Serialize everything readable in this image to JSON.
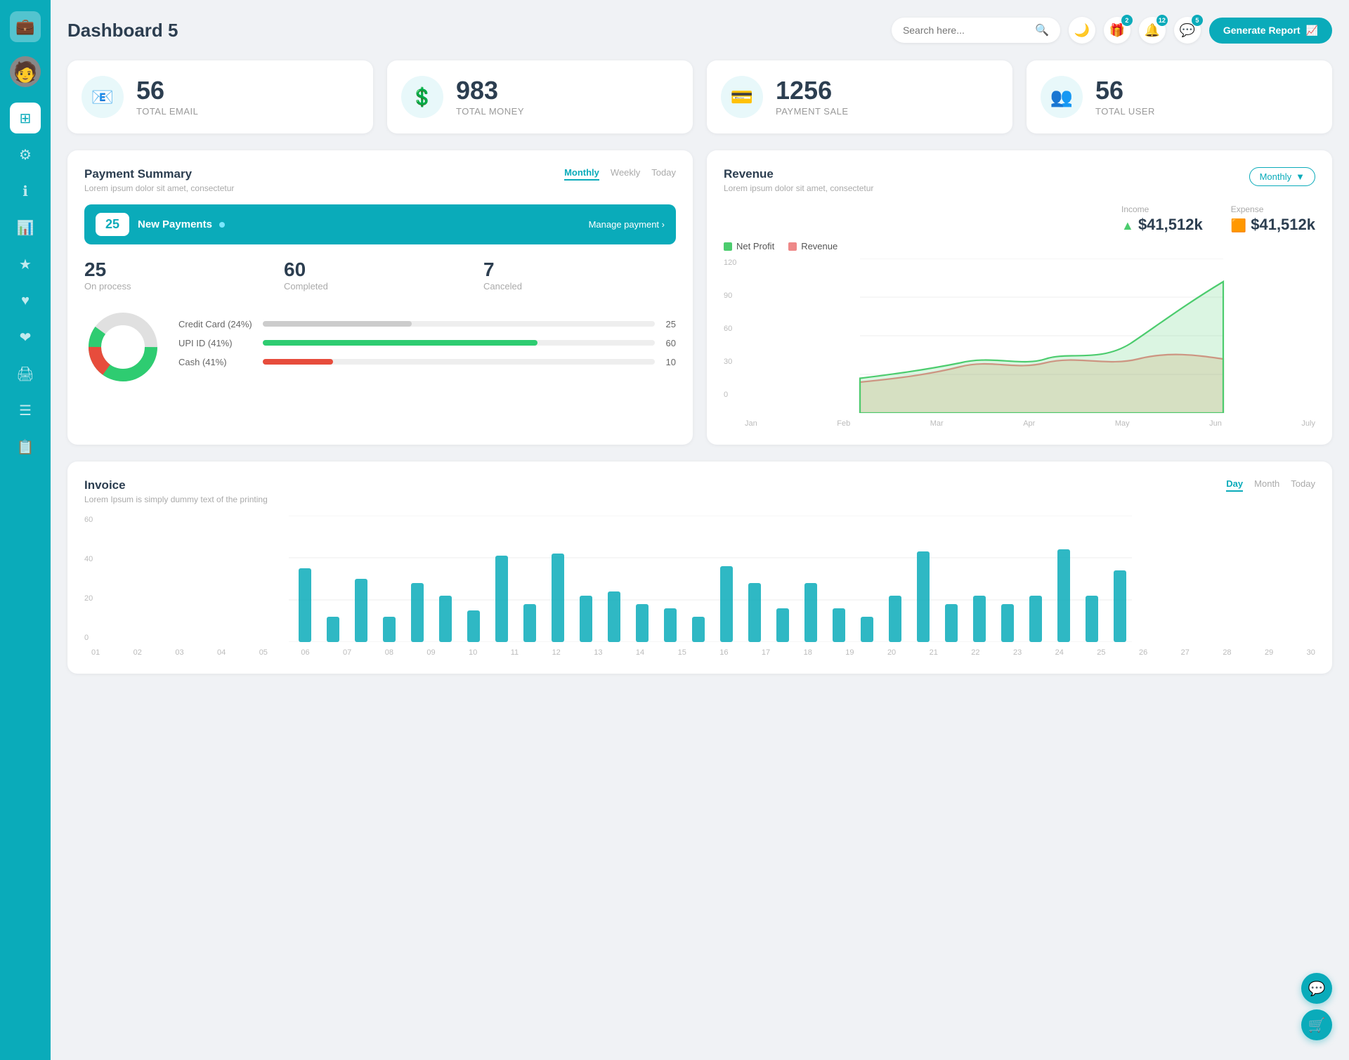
{
  "app": {
    "title": "Dashboard 5"
  },
  "sidebar": {
    "items": [
      {
        "id": "logo",
        "icon": "💼",
        "label": "logo"
      },
      {
        "id": "avatar",
        "icon": "👤",
        "label": "avatar"
      },
      {
        "id": "dashboard",
        "icon": "⊞",
        "label": "dashboard",
        "active": true
      },
      {
        "id": "settings",
        "icon": "⚙",
        "label": "settings"
      },
      {
        "id": "info",
        "icon": "ℹ",
        "label": "info"
      },
      {
        "id": "chart",
        "icon": "📊",
        "label": "chart"
      },
      {
        "id": "star",
        "icon": "★",
        "label": "star"
      },
      {
        "id": "heart",
        "icon": "♥",
        "label": "heart"
      },
      {
        "id": "heart2",
        "icon": "❤",
        "label": "heart2"
      },
      {
        "id": "print",
        "icon": "🖨",
        "label": "print"
      },
      {
        "id": "list",
        "icon": "☰",
        "label": "list"
      },
      {
        "id": "doc",
        "icon": "📋",
        "label": "doc"
      }
    ]
  },
  "header": {
    "title": "Dashboard 5",
    "search_placeholder": "Search here...",
    "badges": {
      "gift": "2",
      "bell": "12",
      "chat": "5"
    },
    "generate_btn": "Generate Report"
  },
  "stat_cards": [
    {
      "id": "email",
      "icon": "📧",
      "num": "56",
      "label": "TOTAL EMAIL"
    },
    {
      "id": "money",
      "icon": "💲",
      "num": "983",
      "label": "TOTAL MONEY"
    },
    {
      "id": "payment",
      "icon": "💳",
      "num": "1256",
      "label": "PAYMENT SALE"
    },
    {
      "id": "user",
      "icon": "👥",
      "num": "56",
      "label": "TOTAL USER"
    }
  ],
  "payment_summary": {
    "title": "Payment Summary",
    "subtitle": "Lorem ipsum dolor sit amet, consectetur",
    "tabs": [
      "Monthly",
      "Weekly",
      "Today"
    ],
    "active_tab": "Monthly",
    "new_payments_count": "25",
    "new_payments_label": "New Payments",
    "manage_link": "Manage payment",
    "on_process": "25",
    "on_process_label": "On process",
    "completed": "60",
    "completed_label": "Completed",
    "canceled": "7",
    "canceled_label": "Canceled",
    "progress_bars": [
      {
        "label": "Credit Card (24%)",
        "value": 24,
        "color": "#ccc",
        "count": "25"
      },
      {
        "label": "UPI ID (41%)",
        "value": 60,
        "color": "#2ecc71",
        "count": "60"
      },
      {
        "label": "Cash (41%)",
        "value": 18,
        "color": "#e74c3c",
        "count": "10"
      }
    ]
  },
  "revenue": {
    "title": "Revenue",
    "subtitle": "Lorem ipsum dolor sit amet, consectetur",
    "dropdown": "Monthly",
    "income_label": "Income",
    "income_value": "$41,512k",
    "expense_label": "Expense",
    "expense_value": "$41,512k",
    "legend": [
      {
        "label": "Net Profit",
        "color": "#4ccc6e"
      },
      {
        "label": "Revenue",
        "color": "#e88"
      }
    ],
    "chart_months": [
      "Jan",
      "Feb",
      "Mar",
      "Apr",
      "May",
      "Jun",
      "July"
    ],
    "chart_y": [
      "120",
      "90",
      "60",
      "30",
      "0"
    ]
  },
  "invoice": {
    "title": "Invoice",
    "subtitle": "Lorem Ipsum is simply dummy text of the printing",
    "tabs": [
      "Day",
      "Month",
      "Today"
    ],
    "active_tab": "Day",
    "y_labels": [
      "60",
      "40",
      "20",
      "0"
    ],
    "x_labels": [
      "01",
      "02",
      "03",
      "04",
      "05",
      "06",
      "07",
      "08",
      "09",
      "10",
      "11",
      "12",
      "13",
      "14",
      "15",
      "16",
      "17",
      "18",
      "19",
      "20",
      "21",
      "22",
      "23",
      "24",
      "25",
      "26",
      "27",
      "28",
      "29",
      "30"
    ],
    "bar_data": [
      35,
      12,
      30,
      12,
      28,
      22,
      15,
      41,
      18,
      42,
      22,
      24,
      18,
      16,
      12,
      36,
      28,
      16,
      28,
      16,
      12,
      22,
      43,
      18,
      22,
      18,
      22,
      44,
      22,
      34
    ]
  },
  "float_btns": [
    {
      "id": "support",
      "icon": "💬"
    },
    {
      "id": "cart",
      "icon": "🛒"
    }
  ]
}
